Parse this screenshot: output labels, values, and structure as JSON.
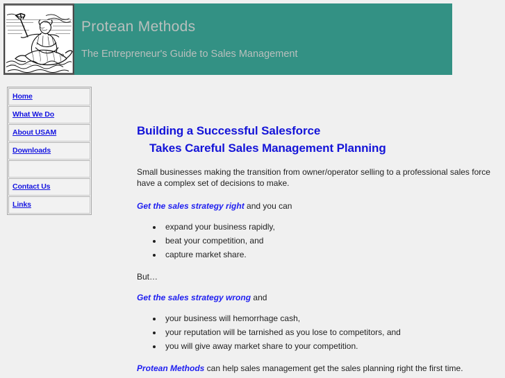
{
  "site": {
    "title": "Protean Methods",
    "tagline": "The Entrepreneur's Guide to Sales Management",
    "banner_color": "#339184",
    "banner_text_color": "#b9bfbd",
    "page_background": "#f0f0f0",
    "logo_alt": "Woodcut engraving of Proteus with trident riding a sea creature"
  },
  "nav": {
    "items": [
      {
        "label": "Home"
      },
      {
        "label": "What We Do"
      },
      {
        "label": "About USAM"
      },
      {
        "label": "Downloads"
      },
      {
        "label": ""
      },
      {
        "label": "Contact Us"
      },
      {
        "label": "Links"
      }
    ],
    "link_color": "#1414e0"
  },
  "main": {
    "heading_line1": "Building a Successful Salesforce",
    "heading_line2": "Takes Careful Sales Management Planning",
    "heading_color": "#1414d8",
    "intro": "Small businesses making the transition from owner/operator selling to a professional sales force have a complex set of decisions to make.",
    "right_lead_emphasis": "Get the sales strategy right",
    "right_lead_rest": " and you can",
    "benefits": [
      "expand your business rapidly,",
      "beat your competition, and",
      "capture market share."
    ],
    "transition": "But…",
    "wrong_lead_emphasis": "Get the sales strategy wrong",
    "wrong_lead_rest": " and",
    "risks": [
      "your business will hemorrhage cash,",
      "your reputation will be tarnished as you lose to competitors, and",
      "you will give away market share to your competition."
    ],
    "closing_emphasis": "Protean Methods",
    "closing_rest": " can help sales management get the sales planning right the first time.",
    "emphasis_color": "#1e1ef0"
  }
}
